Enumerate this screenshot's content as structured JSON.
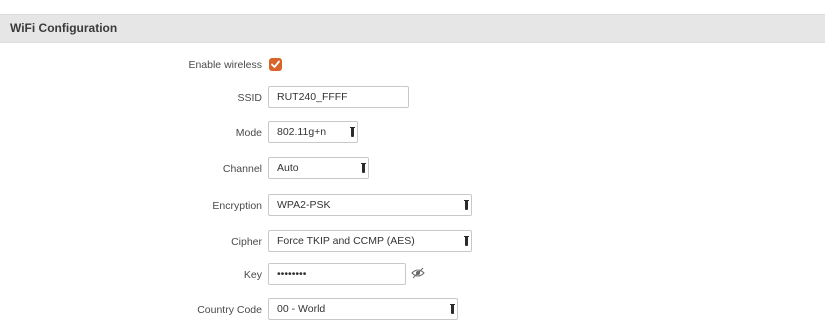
{
  "panel": {
    "title": "WiFi Configuration"
  },
  "form": {
    "enable_wireless": {
      "label": "Enable wireless",
      "checked": true,
      "accent": "#d9642b"
    },
    "ssid": {
      "label": "SSID",
      "value": "RUT240_FFFF"
    },
    "mode": {
      "label": "Mode",
      "value": "802.11g+n"
    },
    "channel": {
      "label": "Channel",
      "value": "Auto"
    },
    "encryption": {
      "label": "Encryption",
      "value": "WPA2-PSK"
    },
    "cipher": {
      "label": "Cipher",
      "value": "Force TKIP and CCMP (AES)"
    },
    "key": {
      "label": "Key",
      "value": "••••••••",
      "reveal_icon": "eye-icon"
    },
    "country_code": {
      "label": "Country Code",
      "value": "00 - World"
    }
  }
}
